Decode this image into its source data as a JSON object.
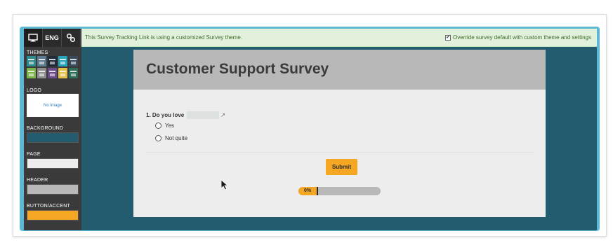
{
  "toolbar": {
    "items": [
      {
        "name": "desktop-icon",
        "label": ""
      },
      {
        "name": "language",
        "label": "ENG"
      },
      {
        "name": "link-icon",
        "label": ""
      }
    ]
  },
  "sidebar": {
    "themes_label": "THEMES",
    "theme_colors": [
      "#2e8b8b",
      "#5a7b8f",
      "#1f2d3a",
      "#29a3b8",
      "#3a4a5a",
      "#7ab648",
      "#8e8e8e",
      "#6b4c8a",
      "#e3c04a",
      "#2f6e5a"
    ],
    "logo_label": "LOGO",
    "logo_placeholder": "No Image",
    "background_label": "BACKGROUND",
    "background_color": "#235c6e",
    "page_label": "PAGE",
    "page_color": "#ededed",
    "header_label": "HEADER",
    "header_color": "#b8b8b8",
    "accent_label": "BUTTON/ACCENT",
    "accent_color": "#f5a623"
  },
  "banner": {
    "text": "This Survey Tracking Link is using a customized Survey theme.",
    "override_checked": true,
    "override_label": "Override survey default with custom theme and settings"
  },
  "survey": {
    "title": "Customer Support Survey",
    "question": "1. Do you love",
    "options": [
      "Yes",
      "Not quite"
    ],
    "submit_label": "Submit",
    "progress_text": "0%",
    "progress_fraction": 0.0
  }
}
